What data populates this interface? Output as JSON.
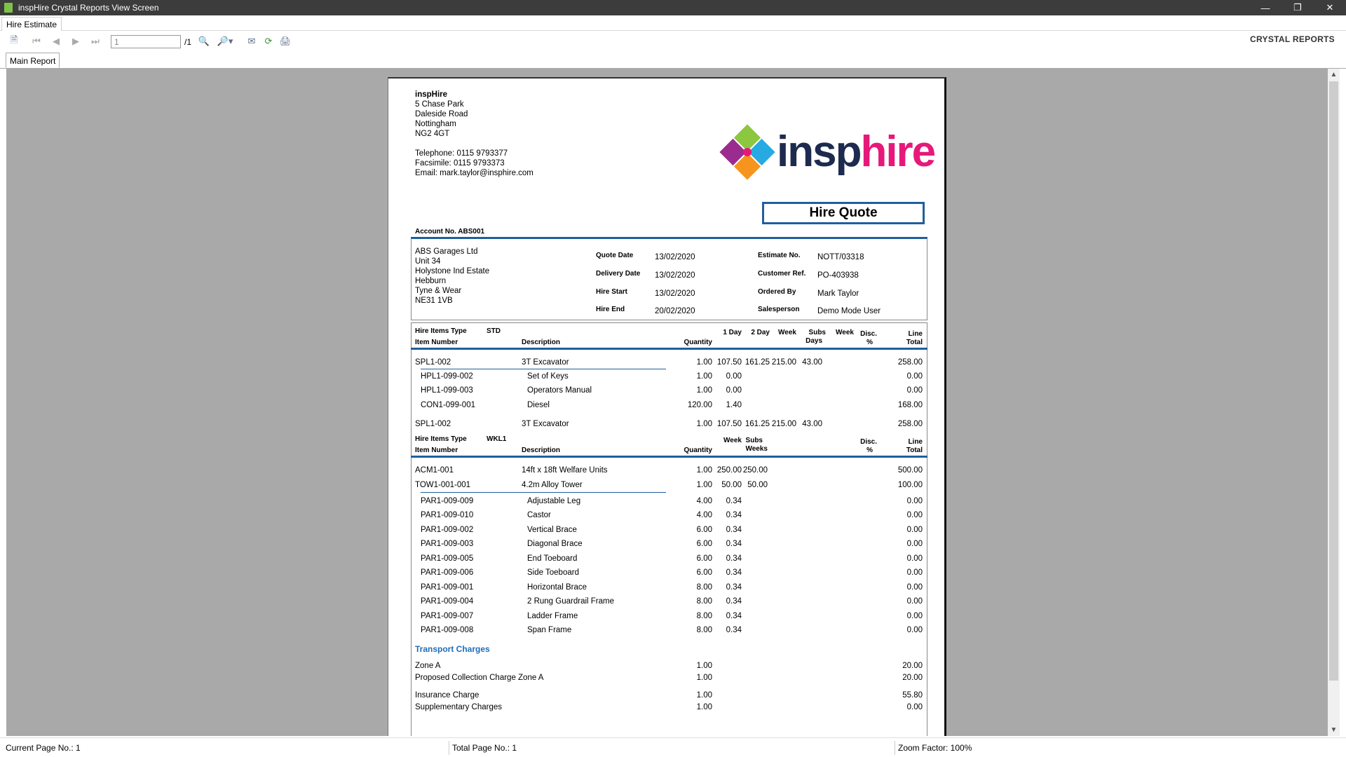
{
  "window": {
    "title": "inspHire Crystal Reports View Screen"
  },
  "menu": {
    "tab": "Hire Estimate"
  },
  "toolbar": {
    "page_value": "1",
    "page_of": "/1",
    "brand": "CRYSTAL REPORTS"
  },
  "tabs": {
    "main": "Main Report"
  },
  "report": {
    "company": {
      "name": "inspHire",
      "lines": [
        "5 Chase Park",
        "Daleside Road",
        "Nottingham",
        "NG2 4GT"
      ],
      "telephone": "Telephone: 0115 9793377",
      "facsimile": "Facsimile: 0115 9793373",
      "email": "Email: mark.taylor@insphire.com"
    },
    "logo": {
      "insp": "insp",
      "hire": "hire"
    },
    "doc_title": "Hire Quote",
    "account": "Account No. ABS001",
    "customer": [
      "ABS Garages Ltd",
      "Unit 34",
      "Holystone Ind Estate",
      "Hebburn",
      "Tyne & Wear",
      "NE31 1VB"
    ],
    "dates": [
      {
        "label": "Quote Date",
        "value": "13/02/2020"
      },
      {
        "label": "Delivery Date",
        "value": "13/02/2020"
      },
      {
        "label": "Hire Start",
        "value": "13/02/2020"
      },
      {
        "label": "Hire End",
        "value": "20/02/2020"
      }
    ],
    "refs": [
      {
        "label": "Estimate No.",
        "value": "NOTT/03318"
      },
      {
        "label": "Customer Ref.",
        "value": "PO-403938"
      },
      {
        "label": "Ordered By",
        "value": "Mark Taylor"
      },
      {
        "label": "Salesperson",
        "value": "Demo Mode User"
      }
    ],
    "std": {
      "type_label": "Hire Items Type",
      "type_value": "STD",
      "headers": {
        "item": "Item Number",
        "desc": "Description",
        "qty": "Quantity",
        "day1": "1 Day",
        "day2": "2 Day",
        "week": "Week",
        "subs_a": "Subs",
        "subs_b": "Days",
        "week2": "Week",
        "disc_a": "Disc.",
        "disc_b": "%",
        "lt_a": "Line",
        "lt_b": "Total"
      },
      "rows": [
        {
          "item": "SPL1-002",
          "desc": "3T Excavator",
          "qty": "1.00",
          "d1": "107.50",
          "d2": "161.25",
          "wk": "215.00",
          "subs": "43.00",
          "total": "258.00",
          "sub": false
        },
        {
          "item": "HPL1-099-002",
          "desc": "Set of Keys",
          "qty": "1.00",
          "d1": "0.00",
          "d2": "",
          "wk": "",
          "subs": "",
          "total": "0.00",
          "sub": true
        },
        {
          "item": "HPL1-099-003",
          "desc": "Operators Manual",
          "qty": "1.00",
          "d1": "0.00",
          "d2": "",
          "wk": "",
          "subs": "",
          "total": "0.00",
          "sub": true
        },
        {
          "item": "CON1-099-001",
          "desc": "Diesel",
          "qty": "120.00",
          "d1": "1.40",
          "d2": "",
          "wk": "",
          "subs": "",
          "total": "168.00",
          "sub": true
        },
        {
          "item": "SPL1-002",
          "desc": "3T Excavator",
          "qty": "1.00",
          "d1": "107.50",
          "d2": "161.25",
          "wk": "215.00",
          "subs": "43.00",
          "total": "258.00",
          "sub": false
        }
      ]
    },
    "wkl": {
      "type_label": "Hire Items Type",
      "type_value": "WKL1",
      "headers": {
        "item": "Item Number",
        "desc": "Description",
        "qty": "Quantity",
        "week": "Week",
        "subs_a": "Subs",
        "subs_b": "Weeks",
        "disc_a": "Disc.",
        "disc_b": "%",
        "lt_a": "Line",
        "lt_b": "Total"
      },
      "rows": [
        {
          "item": "ACM1-001",
          "desc": "14ft x 18ft Welfare Units",
          "qty": "1.00",
          "wk": "250.00",
          "subs": "250.00",
          "total": "500.00",
          "sub": false
        },
        {
          "item": "TOW1-001-001",
          "desc": "4.2m Alloy Tower",
          "qty": "1.00",
          "wk": "50.00",
          "subs": "50.00",
          "total": "100.00",
          "sub": false
        },
        {
          "item": "PAR1-009-009",
          "desc": "Adjustable Leg",
          "qty": "4.00",
          "wk": "0.34",
          "subs": "",
          "total": "0.00",
          "sub": true
        },
        {
          "item": "PAR1-009-010",
          "desc": "Castor",
          "qty": "4.00",
          "wk": "0.34",
          "subs": "",
          "total": "0.00",
          "sub": true
        },
        {
          "item": "PAR1-009-002",
          "desc": "Vertical Brace",
          "qty": "6.00",
          "wk": "0.34",
          "subs": "",
          "total": "0.00",
          "sub": true
        },
        {
          "item": "PAR1-009-003",
          "desc": "Diagonal Brace",
          "qty": "6.00",
          "wk": "0.34",
          "subs": "",
          "total": "0.00",
          "sub": true
        },
        {
          "item": "PAR1-009-005",
          "desc": "End Toeboard",
          "qty": "6.00",
          "wk": "0.34",
          "subs": "",
          "total": "0.00",
          "sub": true
        },
        {
          "item": "PAR1-009-006",
          "desc": "Side Toeboard",
          "qty": "6.00",
          "wk": "0.34",
          "subs": "",
          "total": "0.00",
          "sub": true
        },
        {
          "item": "PAR1-009-001",
          "desc": "Horizontal Brace",
          "qty": "8.00",
          "wk": "0.34",
          "subs": "",
          "total": "0.00",
          "sub": true
        },
        {
          "item": "PAR1-009-004",
          "desc": "2 Rung Guardrail Frame",
          "qty": "8.00",
          "wk": "0.34",
          "subs": "",
          "total": "0.00",
          "sub": true
        },
        {
          "item": "PAR1-009-007",
          "desc": "Ladder Frame",
          "qty": "8.00",
          "wk": "0.34",
          "subs": "",
          "total": "0.00",
          "sub": true
        },
        {
          "item": "PAR1-009-008",
          "desc": "Span Frame",
          "qty": "8.00",
          "wk": "0.34",
          "subs": "",
          "total": "0.00",
          "sub": true
        }
      ]
    },
    "transport": {
      "title": "Transport Charges",
      "rows": [
        {
          "desc": "Zone A",
          "qty": "1.00",
          "total": "20.00"
        },
        {
          "desc": "Proposed Collection Charge Zone A",
          "qty": "1.00",
          "total": "20.00"
        },
        {
          "desc": "Insurance Charge",
          "qty": "1.00",
          "total": "55.80"
        },
        {
          "desc": "Supplementary Charges",
          "qty": "1.00",
          "total": "0.00"
        }
      ]
    }
  },
  "status": {
    "current": "Current Page No.: 1",
    "total": "Total Page No.: 1",
    "zoom": "Zoom Factor: 100%"
  }
}
